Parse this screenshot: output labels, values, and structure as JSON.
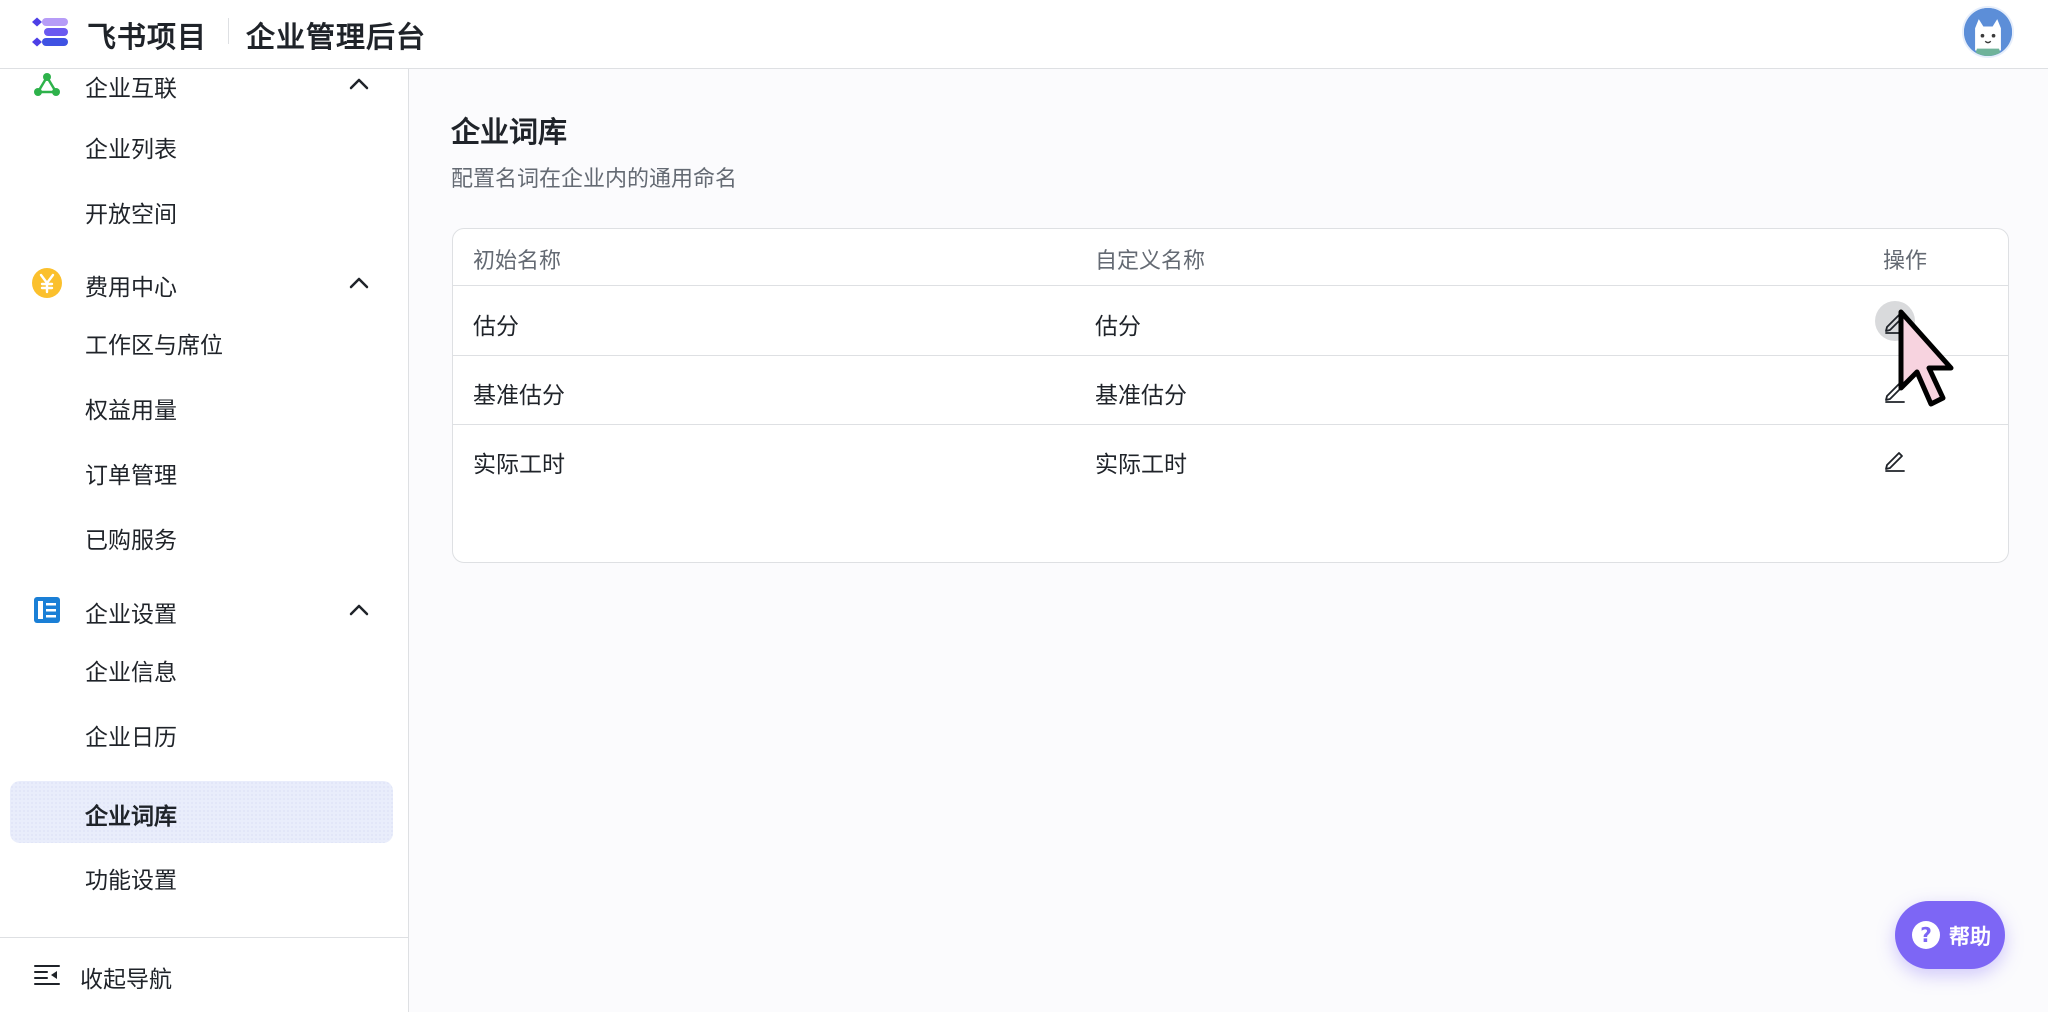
{
  "header": {
    "app_name": "飞书项目",
    "section_title": "企业管理后台",
    "logo_icon": "feishu-project-logo-icon",
    "avatar_icon": "user-avatar-cat-icon"
  },
  "sidebar": {
    "groups": [
      {
        "label": "企业互联",
        "icon": "enterprise-connect-icon",
        "icon_color": "#2eb24b",
        "expanded": true,
        "items": [
          {
            "label": "企业列表"
          },
          {
            "label": "开放空间"
          }
        ]
      },
      {
        "label": "费用中心",
        "icon": "yuan-coin-icon",
        "icon_color": "#fbc02d",
        "expanded": true,
        "items": [
          {
            "label": "工作区与席位"
          },
          {
            "label": "权益用量"
          },
          {
            "label": "订单管理"
          },
          {
            "label": "已购服务"
          }
        ]
      },
      {
        "label": "企业设置",
        "icon": "enterprise-settings-icon",
        "icon_color": "#1a7fd6",
        "expanded": true,
        "items": [
          {
            "label": "企业信息"
          },
          {
            "label": "企业日历"
          },
          {
            "label": "企业词库",
            "active": true
          },
          {
            "label": "功能设置"
          }
        ]
      }
    ],
    "footer_label": "收起导航"
  },
  "main": {
    "title": "企业词库",
    "description": "配置名词在企业内的通用命名",
    "table": {
      "columns": [
        "初始名称",
        "自定义名称",
        "操作"
      ],
      "rows": [
        {
          "original": "估分",
          "custom": "估分"
        },
        {
          "original": "基准估分",
          "custom": "基准估分"
        },
        {
          "original": "实际工时",
          "custom": "实际工时"
        }
      ]
    }
  },
  "help_button": {
    "label": "帮助",
    "icon": "question-circle-icon",
    "color": "#7d66f5"
  },
  "colors": {
    "accent": "#7d66f5",
    "active_nav_bg": "#e9edfb",
    "border": "#dee0e3"
  }
}
